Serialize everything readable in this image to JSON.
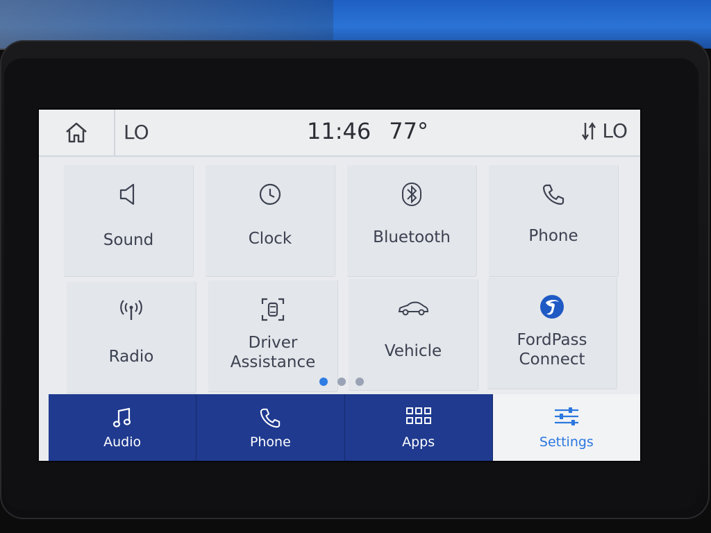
{
  "header": {
    "left_temp": "LO",
    "time": "11:46",
    "outside_temp": "77°",
    "right_temp": "LO"
  },
  "tiles": [
    {
      "label": "Sound",
      "icon": "speaker-icon"
    },
    {
      "label": "Clock",
      "icon": "clock-icon"
    },
    {
      "label": "Bluetooth",
      "icon": "bluetooth-icon"
    },
    {
      "label": "Phone",
      "icon": "phone-icon"
    },
    {
      "label": "Radio",
      "icon": "antenna-icon"
    },
    {
      "label_line1": "Driver",
      "label_line2": "Assistance",
      "icon": "driver-assist-icon"
    },
    {
      "label": "Vehicle",
      "icon": "car-icon"
    },
    {
      "label_line1": "FordPass",
      "label_line2": "Connect",
      "icon": "fordpass-icon"
    }
  ],
  "pagination": {
    "total": 3,
    "active_index": 0
  },
  "bottom_nav": [
    {
      "label": "Audio",
      "icon": "music-note-icon"
    },
    {
      "label": "Phone",
      "icon": "phone-icon"
    },
    {
      "label": "Apps",
      "icon": "grid-icon"
    },
    {
      "label": "Settings",
      "icon": "sliders-icon",
      "selected": true
    }
  ],
  "colors": {
    "accent": "#2e7ce4",
    "nav_bg": "#1f3a8f",
    "screen_bg": "#e9ebee",
    "text": "#3b4150"
  }
}
